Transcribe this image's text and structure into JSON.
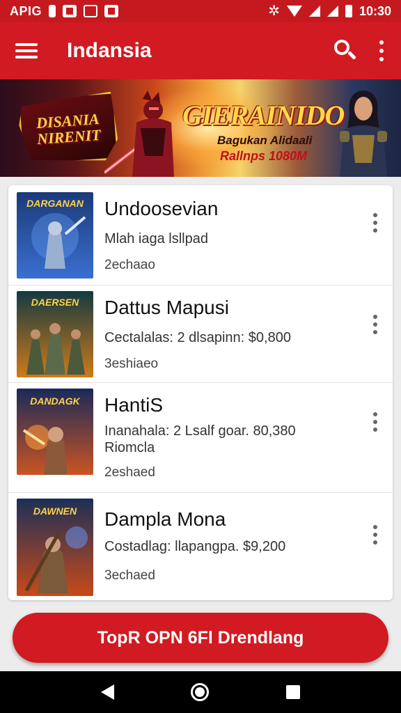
{
  "status_bar": {
    "app_label": "APIG",
    "time": "10:30"
  },
  "app_bar": {
    "title": "Indansia"
  },
  "banner": {
    "logo_line1": "DISANIA",
    "logo_line2": "NIRENIT",
    "title": "GIERAINIDO",
    "subtitle_line1": "Bagukan Alidaali",
    "subtitle_line2": "Rallnps 1080M"
  },
  "list": {
    "items": [
      {
        "title": "Undoosevian",
        "subtitle": "Mlah iaga  lsllpad",
        "subtitle2": "",
        "meta": "2echaao",
        "thumb_label": "DARGANAN",
        "thumb_colors": [
          "#1c3a7a",
          "#3a6fd0"
        ]
      },
      {
        "title": "Dattus Mapusi",
        "subtitle": "Cectalalas: 2 dlsapinn: $0,800",
        "subtitle2": "",
        "meta": "3eshiaeo",
        "thumb_label": "DAERSEN",
        "thumb_colors": [
          "#143a40",
          "#d07a1a"
        ]
      },
      {
        "title": "HantiS",
        "subtitle": "Inanahala: 2 Lsalf goar. 80,380",
        "subtitle2": "Riomcla",
        "meta": "2eshaed",
        "thumb_label": "DANDAGK",
        "thumb_colors": [
          "#1a2a5a",
          "#e05a1a"
        ]
      },
      {
        "title": "Dampla Mona",
        "subtitle": "Costadlag: llapangpa. $9,200",
        "subtitle2": "",
        "meta": "3echaed",
        "thumb_label": "DAWNEN",
        "thumb_colors": [
          "#1c3058",
          "#c84a18"
        ]
      }
    ]
  },
  "cta": {
    "label": "TopR OPN 6Fl Drendlang"
  },
  "colors": {
    "brand_red": "#d21a22",
    "status_red": "#c41a1f"
  }
}
